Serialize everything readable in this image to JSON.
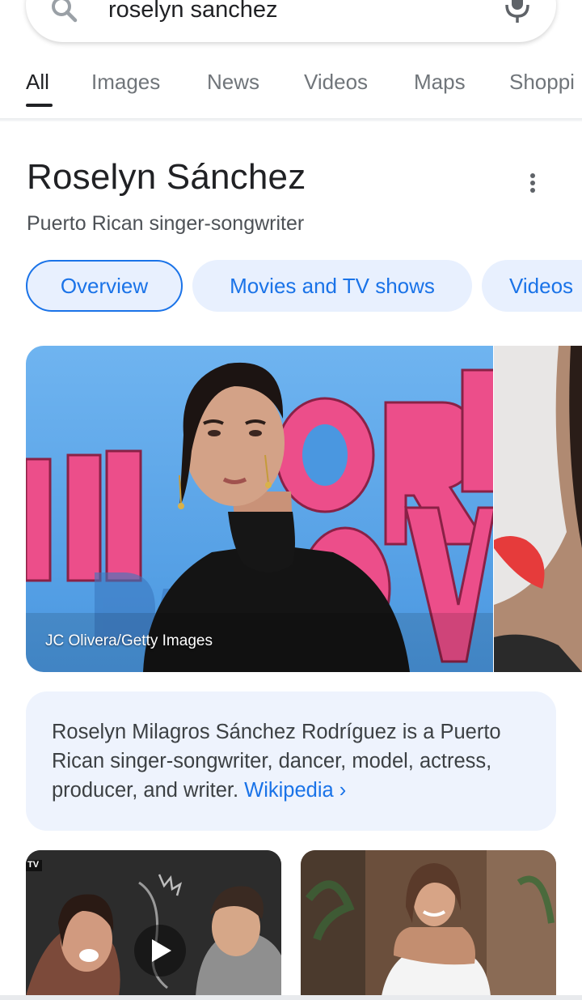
{
  "search": {
    "query": "roselyn sanchez"
  },
  "tabs": [
    {
      "label": "All"
    },
    {
      "label": "Images"
    },
    {
      "label": "News"
    },
    {
      "label": "Videos"
    },
    {
      "label": "Maps"
    },
    {
      "label": "Shoppi"
    }
  ],
  "entity": {
    "title": "Roselyn Sánchez",
    "subtitle": "Puerto Rican singer-songwriter"
  },
  "chips": [
    {
      "label": "Overview"
    },
    {
      "label": "Movies and TV shows"
    },
    {
      "label": "Videos"
    }
  ],
  "image": {
    "credit": "JC Olivera/Getty Images",
    "backdrop_letters": "ILLORA DE OV"
  },
  "description": {
    "text": "Roselyn Milagros Sánchez Rodríguez is a Puerto Rican singer-songwriter, dancer, model, actress, producer, and writer.",
    "link_label": "Wikipedia",
    "link_chevron": "›"
  },
  "videos": {
    "badge": "TV"
  },
  "colors": {
    "accent": "#1a73e8",
    "chip_bg": "#e8f0fe",
    "card_bg": "#eef3fd"
  }
}
